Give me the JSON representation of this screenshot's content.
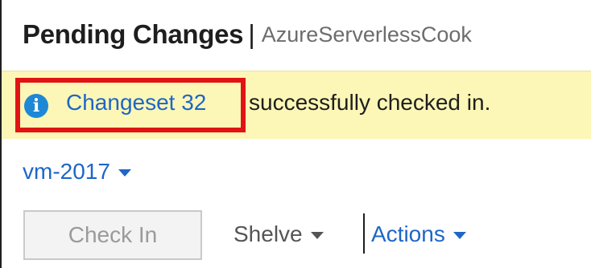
{
  "header": {
    "title": "Pending Changes",
    "separator": "|",
    "subtitle": "AzureServerlessCook"
  },
  "notification": {
    "icon": "info-icon",
    "icon_glyph": "i",
    "link_text": "Changeset 32",
    "message": "successfully checked in.",
    "colors": {
      "background": "#fcf7b6",
      "link": "#1e66c8",
      "highlight_border": "#e11414"
    }
  },
  "workspace": {
    "label": "vm-2017",
    "icon": "chevron-down-icon"
  },
  "toolbar": {
    "check_in_label": "Check In",
    "shelve_label": "Shelve",
    "actions_label": "Actions"
  }
}
